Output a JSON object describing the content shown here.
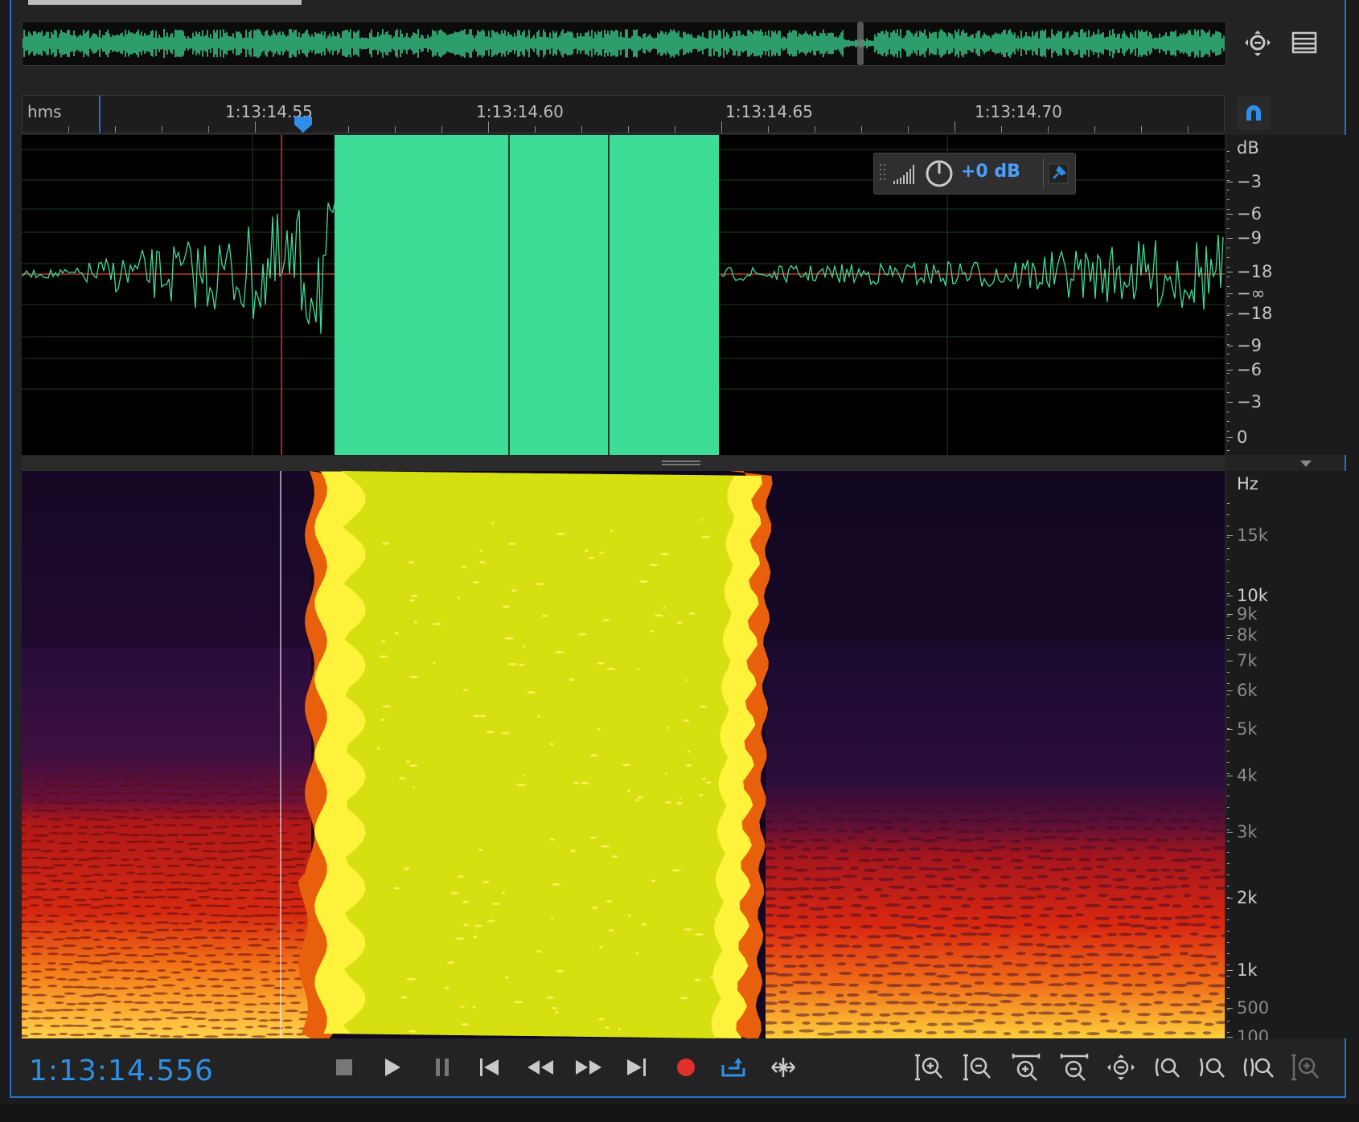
{
  "ruler": {
    "unit_label": "hms",
    "time_labels": [
      "1:13:14.55",
      "1:13:14.60",
      "1:13:14.65",
      "1:13:14.70"
    ]
  },
  "waveform": {
    "db_labels": [
      "dB",
      "−3",
      "−6",
      "−9",
      "−18",
      "−∞",
      "−18",
      "−9",
      "−6",
      "−3",
      "0"
    ]
  },
  "gain_hud": {
    "value": "+0 dB"
  },
  "spectrogram": {
    "hz_labels": [
      "Hz",
      "15k",
      "10k",
      "9k",
      "8k",
      "7k",
      "6k",
      "5k",
      "4k",
      "3k",
      "2k",
      "1k",
      "500",
      "100"
    ]
  },
  "transport": {
    "time_readout": "1:13:14.556"
  },
  "colors": {
    "accent": "#2f8fe8",
    "waveform": "#3ddc97",
    "playhead": "#e0302a",
    "spectrum_hot": "#d6e010"
  },
  "icons": {
    "zoom_fit": "zoom-icon",
    "panel_menu": "menu-icon",
    "snap": "magnet-icon",
    "stop": "stop-icon",
    "play": "play-icon",
    "pause": "pause-icon",
    "go_start": "skip-start-icon",
    "rewind": "rewind-icon",
    "fast_forward": "fast-forward-icon",
    "go_end": "skip-end-icon",
    "record": "record-icon",
    "loop": "loop-icon",
    "skip_selection": "skip-selection-icon"
  }
}
